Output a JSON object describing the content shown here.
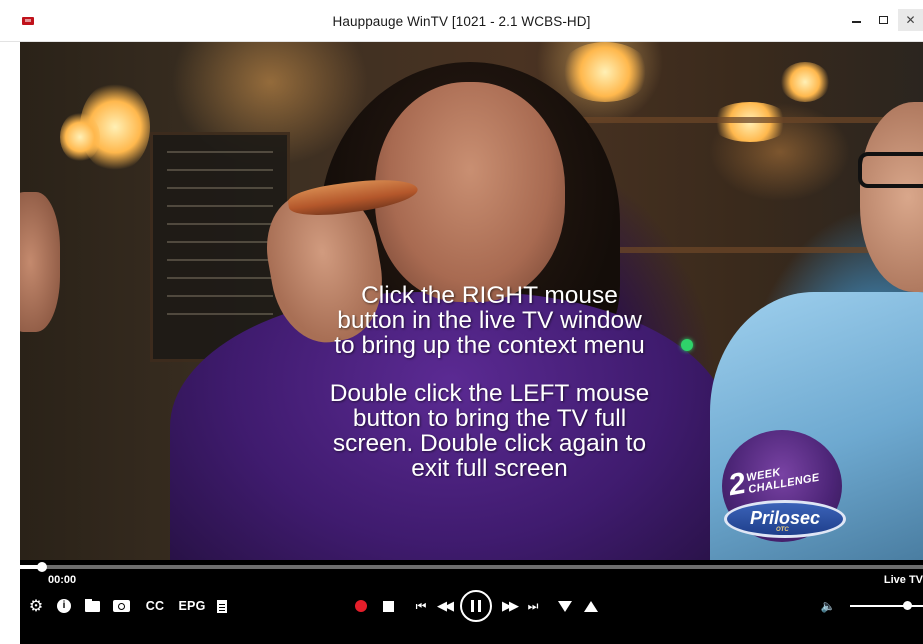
{
  "window": {
    "title": "Hauppauge WinTV [1021 - 2.1   WCBS-HD]",
    "minimize_icon": "minimize-icon",
    "maximize_icon": "maximize-icon",
    "close_glyph": "✕"
  },
  "video": {
    "hint_right_click": [
      "Click the RIGHT mouse",
      "button in the live TV window",
      "to bring up the context menu"
    ],
    "hint_double_click": [
      "Double click the LEFT mouse",
      "button to bring the TV full",
      "screen. Double click again to",
      "exit full screen"
    ],
    "ad_badge": {
      "number": "2",
      "line1": "WEEK",
      "line2": "CHALLENGE",
      "brand": "Prilosec",
      "otc": "OTC"
    }
  },
  "controls": {
    "elapsed": "00:00",
    "mode": "Live TV",
    "seek_fraction": 0.024,
    "volume_fraction": 0.78,
    "buttons": {
      "cc": "CC",
      "epg": "EPG"
    },
    "icons": {
      "settings": "gear-icon",
      "info": "info-icon",
      "folder": "folder-icon",
      "snapshot": "camera-icon",
      "schedule": "document-icon",
      "record": "record-icon",
      "stop": "stop-icon",
      "prev": "skip-back-icon",
      "rewind": "rewind-icon",
      "pause": "pause-icon",
      "fast_forward": "fast-forward-icon",
      "next": "skip-forward-icon",
      "channel_down": "channel-down-icon",
      "channel_up": "channel-up-icon",
      "volume": "volume-icon"
    },
    "glyphs": {
      "gear": "⚙",
      "info": "i",
      "prev": "⏮",
      "rew": "◀◀",
      "ffw": "▶▶",
      "next": "⏭",
      "volume": "🔈"
    }
  },
  "colors": {
    "record": "#e51e2a",
    "indicator": "#2fd26a",
    "control_bar": "#000000"
  }
}
